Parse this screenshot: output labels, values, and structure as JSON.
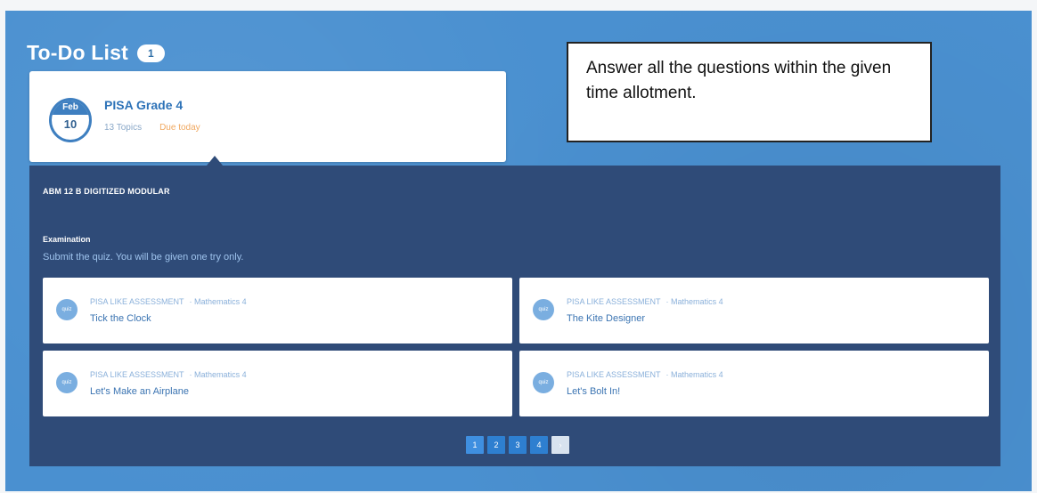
{
  "todo": {
    "title": "To-Do List",
    "count": "1"
  },
  "card": {
    "month": "Feb",
    "day": "10",
    "title": "PISA Grade 4",
    "topics": "13 Topics",
    "due": "Due today"
  },
  "note": {
    "text": "Answer all the questions within the given time allotment."
  },
  "detail": {
    "course": "ABM 12 B DIGITIZED MODULAR",
    "exam_label": "Examination",
    "exam_desc": "Submit the quiz. You will be given one try only.",
    "items": [
      {
        "category": "PISA LIKE ASSESSMENT",
        "subject": "Mathematics 4",
        "name": "Tick the Clock",
        "icon": "quiz-icon"
      },
      {
        "category": "PISA LIKE ASSESSMENT",
        "subject": "Mathematics 4",
        "name": "The Kite Designer",
        "icon": "quiz-icon"
      },
      {
        "category": "PISA LIKE ASSESSMENT",
        "subject": "Mathematics 4",
        "name": "Let's Make an Airplane",
        "icon": "quiz-icon"
      },
      {
        "category": "PISA LIKE ASSESSMENT",
        "subject": "Mathematics 4",
        "name": "Let's Bolt In!",
        "icon": "quiz-icon"
      }
    ]
  },
  "pagination": {
    "pages": [
      "1",
      "2",
      "3",
      "4"
    ],
    "next": "›"
  },
  "colors": {
    "background": "#4a90d0",
    "detail_panel": "#2f4b78",
    "accent": "#2e73b8",
    "due": "#f0a860"
  }
}
